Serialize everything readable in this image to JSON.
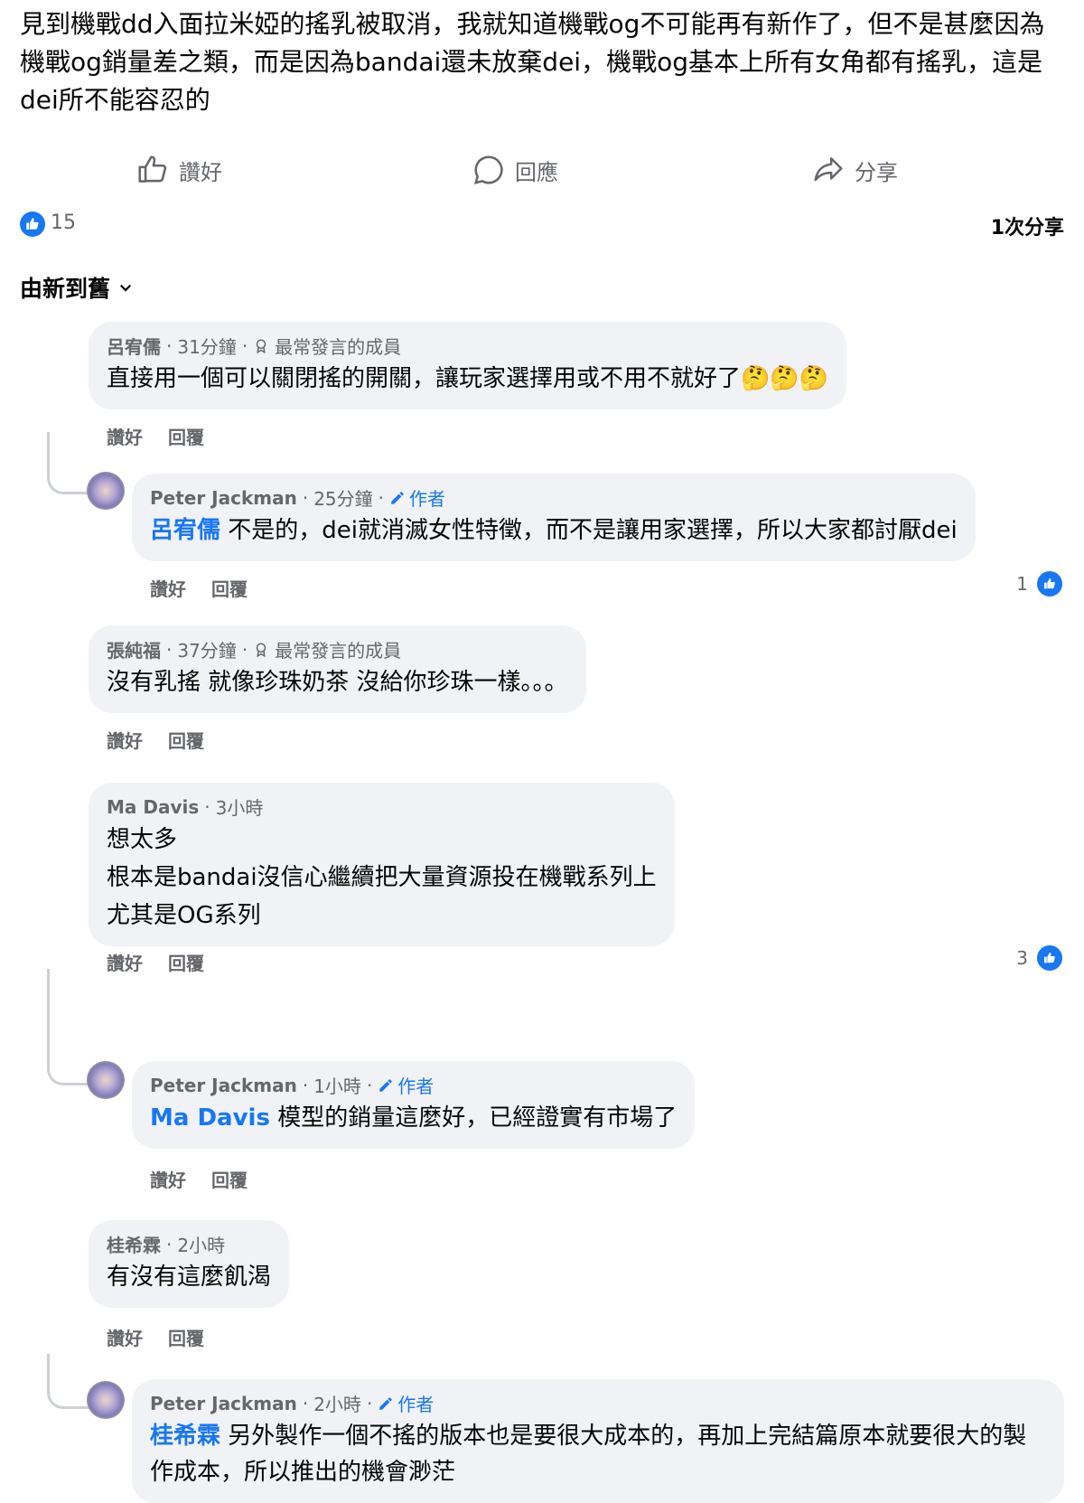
{
  "post": {
    "text": "見到機戰dd入面拉米婭的搖乳被取消，我就知道機戰og不可能再有新作了，但不是甚麼因為機戰og銷量差之類，而是因為bandai還未放棄dei，機戰og基本上所有女角都有搖乳，這是dei所不能容忍的"
  },
  "actions": {
    "like": "讚好",
    "reply": "回應",
    "share": "分享"
  },
  "counts": {
    "likes": "15",
    "shares": "1次分享"
  },
  "sort": {
    "label": "由新到舊"
  },
  "comments": [
    {
      "name": "呂宥儒",
      "time": "31分鐘",
      "badge": "最常發言的成員",
      "text": "直接用一個可以關閉搖的開關，讓玩家選擇用或不用不就好了",
      "emoji": "🤔🤔🤔",
      "like": "讚好",
      "reply": "回覆",
      "replies": [
        {
          "name": "Peter Jackman",
          "time": "25分鐘",
          "author": "作者",
          "mention": "呂宥儒",
          "text": " 不是的，dei就消滅女性特徵，而不是讓用家選擇，所以大家都討厭dei",
          "like": "讚好",
          "reply": "回覆",
          "reactions": "1"
        }
      ]
    },
    {
      "name": "張純福",
      "time": "37分鐘",
      "badge": "最常發言的成員",
      "text": "沒有乳搖 就像珍珠奶茶 沒給你珍珠一樣。。。",
      "like": "讚好",
      "reply": "回覆"
    },
    {
      "name": "Ma Davis",
      "time": "3小時",
      "lines": [
        "想太多",
        "根本是bandai沒信心繼續把大量資源投在機戰系列上",
        "尤其是OG系列"
      ],
      "like": "讚好",
      "reply": "回覆",
      "reactions": "3",
      "replies": [
        {
          "name": "Peter Jackman",
          "time": "1小時",
          "author": "作者",
          "mention": "Ma Davis",
          "text": " 模型的銷量這麼好，已經證實有市場了",
          "like": "讚好",
          "reply": "回覆"
        }
      ]
    },
    {
      "name": "桂希霖",
      "time": "2小時",
      "text": "有沒有這麼飢渴",
      "like": "讚好",
      "reply": "回覆",
      "replies": [
        {
          "name": "Peter Jackman",
          "time": "2小時",
          "author": "作者",
          "mention": "桂希霖",
          "text": " 另外製作一個不搖的版本也是要很大成本的，再加上完結篇原本就要很大的製作成本，所以推出的機會￼渺茫"
        }
      ]
    }
  ]
}
